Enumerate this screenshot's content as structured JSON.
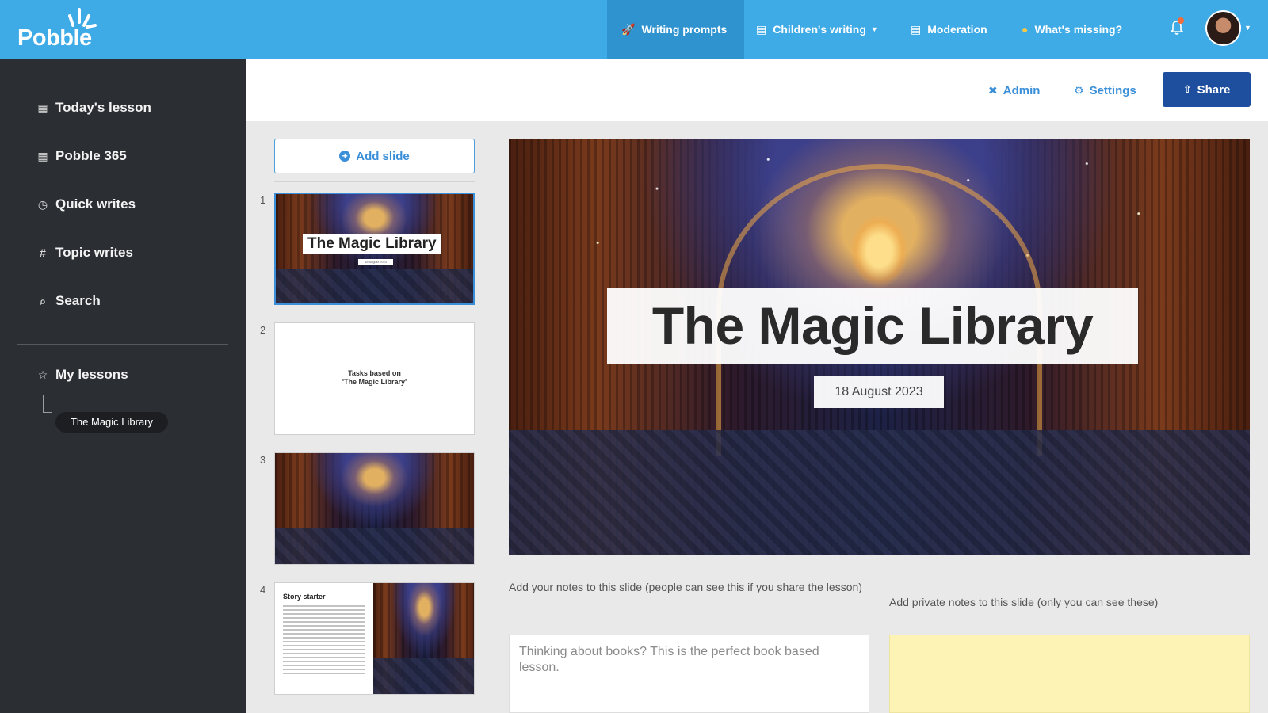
{
  "app": {
    "brand": "Pobble",
    "colors": {
      "topbar": "#3eaae6",
      "sidebar": "#2b2e33",
      "accent": "#3b8fd8",
      "share": "#1e4f9e"
    }
  },
  "topnav": {
    "items": [
      {
        "label": "Writing prompts",
        "icon": "rocket-icon",
        "active": true
      },
      {
        "label": "Children's writing",
        "icon": "document-icon",
        "has_dropdown": true
      },
      {
        "label": "Moderation",
        "icon": "document-check-icon"
      },
      {
        "label": "What's missing?",
        "icon": "lightbulb-icon"
      }
    ],
    "notifications_icon": "bell-icon",
    "avatar": "user-avatar"
  },
  "sidebar": {
    "items": [
      {
        "label": "Today's lesson",
        "icon": "calendar-icon"
      },
      {
        "label": "Pobble 365",
        "icon": "calendar-icon"
      },
      {
        "label": "Quick writes",
        "icon": "stopwatch-icon"
      },
      {
        "label": "Topic writes",
        "icon": "hash-icon"
      },
      {
        "label": "Search",
        "icon": "search-icon"
      }
    ],
    "my_lessons": {
      "label": "My lessons",
      "icon": "star-icon",
      "lessons": [
        "The Magic Library"
      ]
    }
  },
  "toolbar": {
    "admin_label": "Admin",
    "settings_label": "Settings",
    "share_label": "Share"
  },
  "slides": {
    "add_label": "Add slide",
    "items": [
      {
        "number": "1",
        "title": "The Magic Library",
        "date": "18 August 2023"
      },
      {
        "number": "2",
        "text_line1": "Tasks based on",
        "text_line2": "'The Magic Library'"
      },
      {
        "number": "3"
      },
      {
        "number": "4",
        "heading": "Story starter"
      }
    ]
  },
  "main_slide": {
    "title": "The Magic Library",
    "date": "18 August 2023"
  },
  "notes": {
    "public_label": "Add your notes to this slide (people can see this if you share the lesson)",
    "public_value": "Thinking about books? This is the perfect book based lesson.",
    "private_label": "Add private notes to this slide (only you can see these)",
    "private_value": ""
  }
}
